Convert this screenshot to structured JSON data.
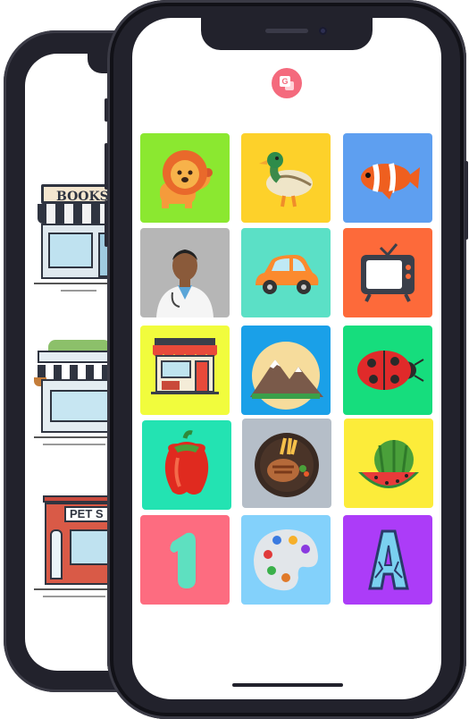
{
  "back_screen": {
    "shops": [
      {
        "name": "bookstore",
        "sign": "BOOKS"
      },
      {
        "name": "flower-shop",
        "sign": ""
      },
      {
        "name": "pet-shop",
        "sign": "PET S"
      }
    ]
  },
  "front_screen": {
    "top_icon": "translate-icon",
    "top_icon_color": "#f46a7d",
    "tiles": [
      {
        "item": "lion",
        "color": "#8be830"
      },
      {
        "item": "duck",
        "color": "#fdd12a"
      },
      {
        "item": "clownfish",
        "color": "#5e9ff0"
      },
      {
        "item": "doctor",
        "color": "#b6b6b6"
      },
      {
        "item": "car",
        "color": "#5be0c6"
      },
      {
        "item": "television",
        "color": "#fd6a3a"
      },
      {
        "item": "store",
        "color": "#f1fc3d"
      },
      {
        "item": "mountains",
        "color": "#1aa0e8"
      },
      {
        "item": "ladybug",
        "color": "#16dd7d"
      },
      {
        "item": "bell-pepper",
        "color": "#23e3b2"
      },
      {
        "item": "steak-plate",
        "color": "#b5bec8"
      },
      {
        "item": "watermelon",
        "color": "#fcec3a"
      },
      {
        "item": "number-one",
        "color": "#fd6c80"
      },
      {
        "item": "paint-palette",
        "color": "#83d1fb"
      },
      {
        "item": "letter-a",
        "color": "#ac3cf8"
      }
    ],
    "tile_texts": {
      "number": "1",
      "letter": "A"
    }
  }
}
